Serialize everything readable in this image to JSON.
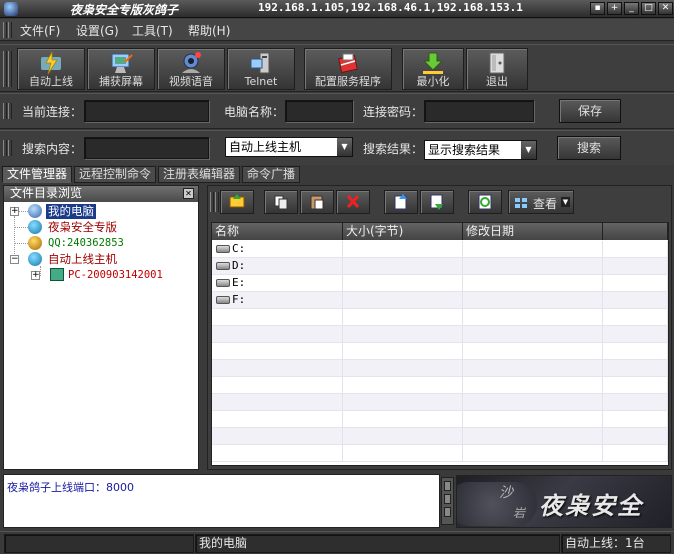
{
  "window": {
    "title": "夜枭安全专版灰鸽子",
    "ips": "192.168.1.105,192.168.46.1,192.168.153.1",
    "buttons": [
      "▪",
      "+",
      "_",
      "□",
      "✕"
    ]
  },
  "menu": [
    "文件(F)",
    "设置(G)",
    "工具(T)",
    "帮助(H)"
  ],
  "toolbar": [
    {
      "label": "自动上线",
      "icon": "auto-online-icon"
    },
    {
      "label": "捕获屏幕",
      "icon": "capture-screen-icon"
    },
    {
      "label": "视频语音",
      "icon": "video-voice-icon"
    },
    {
      "label": "Telnet",
      "icon": "telnet-icon"
    },
    {
      "label": "配置服务程序",
      "icon": "config-service-icon"
    },
    {
      "label": "最小化",
      "icon": "minimize-icon"
    },
    {
      "label": "退出",
      "icon": "exit-icon"
    }
  ],
  "connection": {
    "current_label": "当前连接：",
    "current_value": "",
    "pc_name_label": "电脑名称：",
    "pc_name_value": "",
    "password_label": "连接密码：",
    "password_value": "",
    "save_label": "保存"
  },
  "search": {
    "content_label": "搜索内容：",
    "content_value": "",
    "scope_value": "自动上线主机",
    "result_label": "搜索结果：",
    "result_value": "显示搜索结果",
    "search_label": "搜索"
  },
  "tabs": [
    "文件管理器",
    "远程控制命令",
    "注册表编辑器",
    "命令广播"
  ],
  "tree": {
    "header": "文件目录浏览",
    "nodes": [
      {
        "label": "我的电脑",
        "color": "#ffffff",
        "selected": true
      },
      {
        "label": "夜枭安全专版",
        "color": "#a00000"
      },
      {
        "label": "QQ:240362853",
        "color": "#007a00"
      },
      {
        "label": "自动上线主机",
        "color": "#a00000"
      },
      {
        "label": "PC-200903142001",
        "color": "#c00000"
      }
    ]
  },
  "file_toolbar": {
    "view_label": "查看",
    "icons": [
      "up-folder-icon",
      "copy-icon",
      "paste-icon",
      "delete-icon",
      "upload-icon",
      "download-icon",
      "refresh-icon",
      "view-icon"
    ]
  },
  "files": {
    "columns": [
      "名称",
      "大小(字节)",
      "修改日期",
      ""
    ],
    "drives": [
      "C:",
      "D:",
      "E:",
      "F:"
    ]
  },
  "log": {
    "text": "夜枭鸽子上线端口：8000"
  },
  "logo": {
    "text": "夜枭安全",
    "sub1": "沙",
    "sub2": "岩"
  },
  "status": {
    "left": "",
    "middle": "我的电脑",
    "right": "自动上线：1台"
  }
}
